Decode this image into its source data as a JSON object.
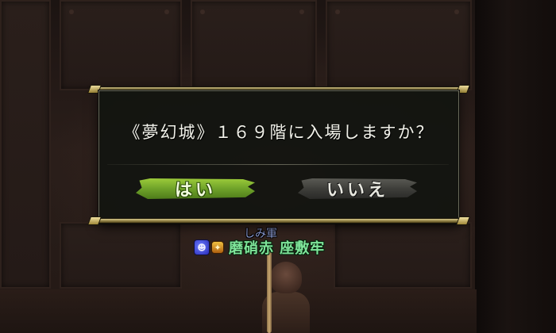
{
  "dialog": {
    "message": "《夢幻城》１６９階に入場しますか？",
    "yes_label": "はい",
    "no_label": "いいえ",
    "selected": "yes"
  },
  "player": {
    "guild": "しみ軍",
    "name": "磨硝赤 座敷牢",
    "name_color": "#7fe59a",
    "guild_color": "#8f9fd8",
    "faction_icon": "blue-faction-crest-icon",
    "rank_icon": "gold-rank-icon"
  },
  "colors": {
    "yes_button": "#7fb030",
    "no_button": "#444440",
    "dialog_border": "#d8c88a"
  }
}
